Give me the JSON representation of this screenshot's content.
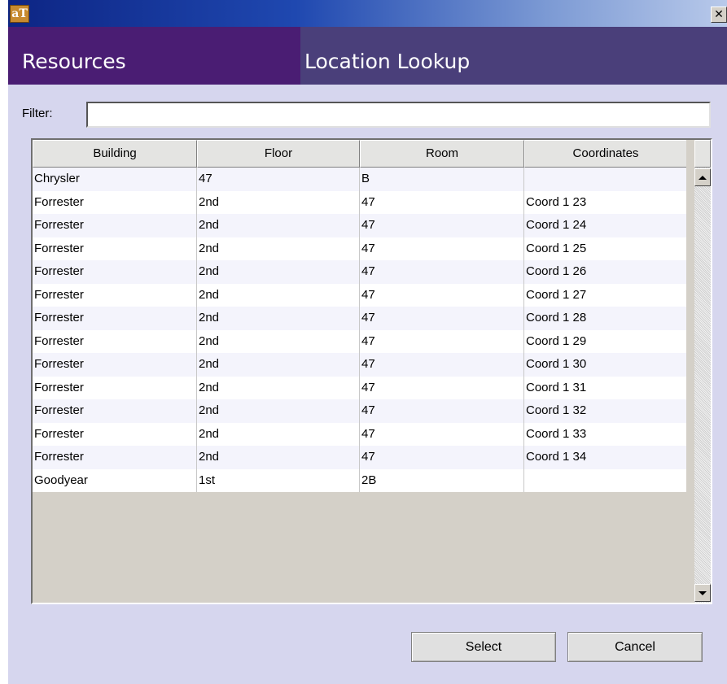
{
  "window": {
    "app_icon": "aT",
    "close_glyph": "✕"
  },
  "header": {
    "left_title": "Resources",
    "right_title": "Location Lookup"
  },
  "filter": {
    "label": "Filter:",
    "value": "",
    "placeholder": ""
  },
  "table": {
    "columns": [
      "Building",
      "Floor",
      "Room",
      "Coordinates"
    ],
    "rows": [
      [
        "Chrysler",
        "47",
        "B",
        ""
      ],
      [
        "Forrester",
        "2nd",
        "47",
        "Coord 1 23"
      ],
      [
        "Forrester",
        "2nd",
        "47",
        "Coord 1 24"
      ],
      [
        "Forrester",
        "2nd",
        "47",
        "Coord 1 25"
      ],
      [
        "Forrester",
        "2nd",
        "47",
        "Coord 1 26"
      ],
      [
        "Forrester",
        "2nd",
        "47",
        "Coord 1 27"
      ],
      [
        "Forrester",
        "2nd",
        "47",
        "Coord 1 28"
      ],
      [
        "Forrester",
        "2nd",
        "47",
        "Coord 1 29"
      ],
      [
        "Forrester",
        "2nd",
        "47",
        "Coord 1 30"
      ],
      [
        "Forrester",
        "2nd",
        "47",
        "Coord 1 31"
      ],
      [
        "Forrester",
        "2nd",
        "47",
        "Coord 1 32"
      ],
      [
        "Forrester",
        "2nd",
        "47",
        "Coord 1 33"
      ],
      [
        "Forrester",
        "2nd",
        "47",
        "Coord 1 34"
      ],
      [
        "Goodyear",
        "1st",
        "2B",
        ""
      ]
    ]
  },
  "buttons": {
    "select": "Select",
    "cancel": "Cancel"
  },
  "colors": {
    "header_left": "#4a1d73",
    "header_right": "#4a3f7a",
    "window_background": "#d6d6ee"
  }
}
